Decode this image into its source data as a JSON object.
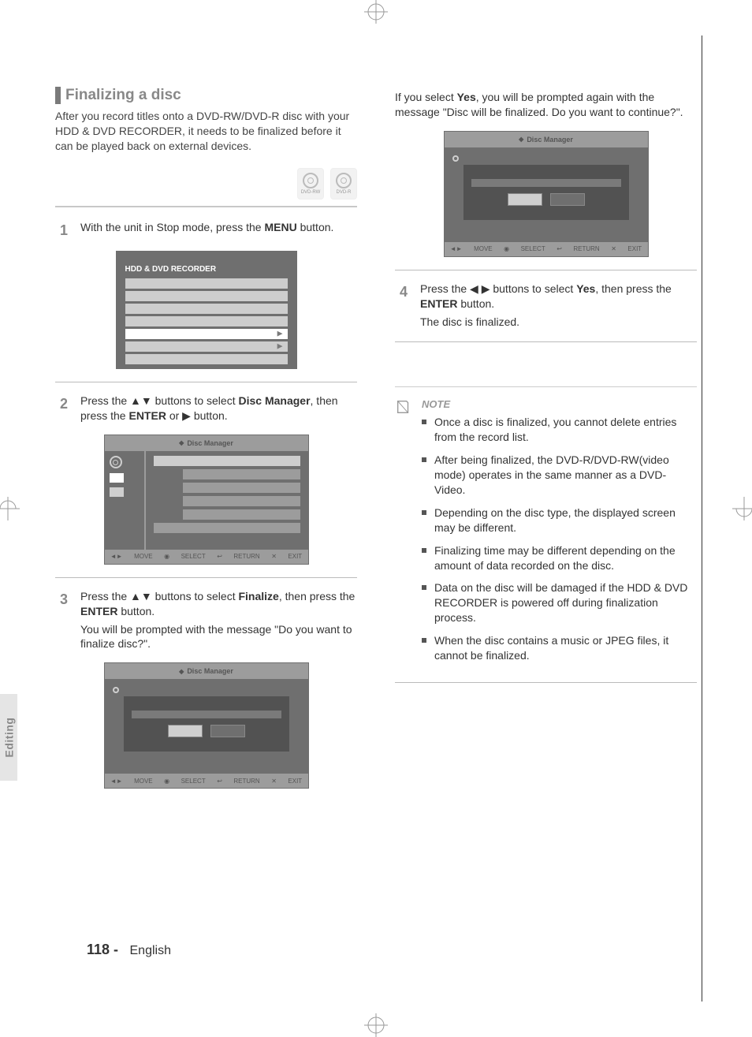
{
  "page": {
    "section_tab": "Editing",
    "page_number": "118 -",
    "language": "English"
  },
  "heading": "Finalizing a disc",
  "intro": "After you record titles onto a DVD-RW/DVD-R disc with your HDD & DVD RECORDER, it needs to be finalized before it can be played back on external devices.",
  "disc_labels": {
    "rw": "DVD-RW",
    "r": "DVD-R"
  },
  "steps": {
    "s1_pre": "With the unit in Stop mode, press the ",
    "s1_btn": "MENU",
    "s1_post": " button.",
    "s2_pre": "Press the ",
    "s2_mid": " buttons to select ",
    "s2_item": "Disc Manager",
    "s2_post1": ", then press the ",
    "s2_btn": "ENTER",
    "s2_post2": " or ",
    "s2_post3": " button.",
    "s3_pre": "Press the ",
    "s3_mid": " buttons to select ",
    "s3_item": "Finalize",
    "s3_post1": ", then press the ",
    "s3_btn": "ENTER",
    "s3_post2": " button.",
    "s3_after": "You will be prompted with the message \"Do you want to finalize disc?\".",
    "s4_pre": "If you select ",
    "s4_item": "Yes",
    "s4_post1": ", you will be prompted again with the message ",
    "s4_msg": "\"Disc will be finalized. Do you want to continue?\".",
    "s5_pre": "Press the ",
    "s5_mid": " buttons to select ",
    "s5_item": "Yes",
    "s5_post1": ", then press the ",
    "s5_btn": "ENTER",
    "s5_post2": " button.",
    "s5_after": "The disc is finalized."
  },
  "notes_label": "NOTE",
  "notes": [
    "Once a disc is finalized, you cannot delete entries from the record list.",
    "After being finalized, the DVD-R/DVD-RW(video mode) operates in the same manner as a DVD-Video.",
    "Depending on the disc type, the displayed screen may be different.",
    "Finalizing time may be different depending on the amount of data recorded on the disc.",
    "Data on the disc will be damaged if the HDD & DVD RECORDER is powered off during finalization process.",
    "When the disc contains a music or JPEG files, it cannot be finalized."
  ],
  "menu_shot": {
    "title": "HDD & DVD RECORDER"
  },
  "dm_head": "Disc Manager",
  "capbar": [
    "MOVE",
    "SELECT",
    "RETURN",
    "EXIT"
  ]
}
